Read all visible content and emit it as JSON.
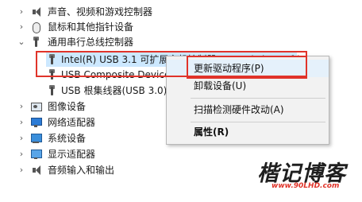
{
  "tree": {
    "top_row": "声音、视频和游戏控制器",
    "rows": [
      {
        "label": "鼠标和其他指针设备",
        "icon": "mouse-icon",
        "expanded": false
      },
      {
        "label": "通用串行总线控制器",
        "icon": "usb-icon",
        "expanded": true,
        "children": [
          {
            "label": "Intel(R) USB 3.1 可扩展主机控制器 - 1.10 (Microsoft)",
            "icon": "usb-icon",
            "selected": true
          },
          {
            "label": "USB Composite Device",
            "icon": "usb-icon"
          },
          {
            "label": "USB 根集线器(USB 3.0)",
            "icon": "usb-icon"
          }
        ]
      },
      {
        "label": "图像设备",
        "icon": "image-device-icon",
        "expanded": false
      },
      {
        "label": "网络适配器",
        "icon": "network-adapter-icon",
        "expanded": false
      },
      {
        "label": "系统设备",
        "icon": "system-device-icon",
        "expanded": false
      },
      {
        "label": "显示适配器",
        "icon": "display-adapter-icon",
        "expanded": false
      },
      {
        "label": "音频输入和输出",
        "icon": "speaker-icon",
        "expanded": false
      }
    ]
  },
  "context_menu": {
    "items": [
      {
        "label": "更新驱动程序(P)",
        "bold": false,
        "highlighted": true
      },
      {
        "label": "卸载设备(U)",
        "bold": false
      },
      {
        "label": "扫描检测硬件改动(A)",
        "bold": false
      },
      {
        "label": "属性(R)",
        "bold": true
      }
    ]
  },
  "watermark": {
    "title": "楷记博客",
    "url": "www.90LHD.com"
  },
  "colors": {
    "highlight_box": "#e0342a",
    "selection": "#cce8ff",
    "menu_bg": "#f2f2f2"
  }
}
